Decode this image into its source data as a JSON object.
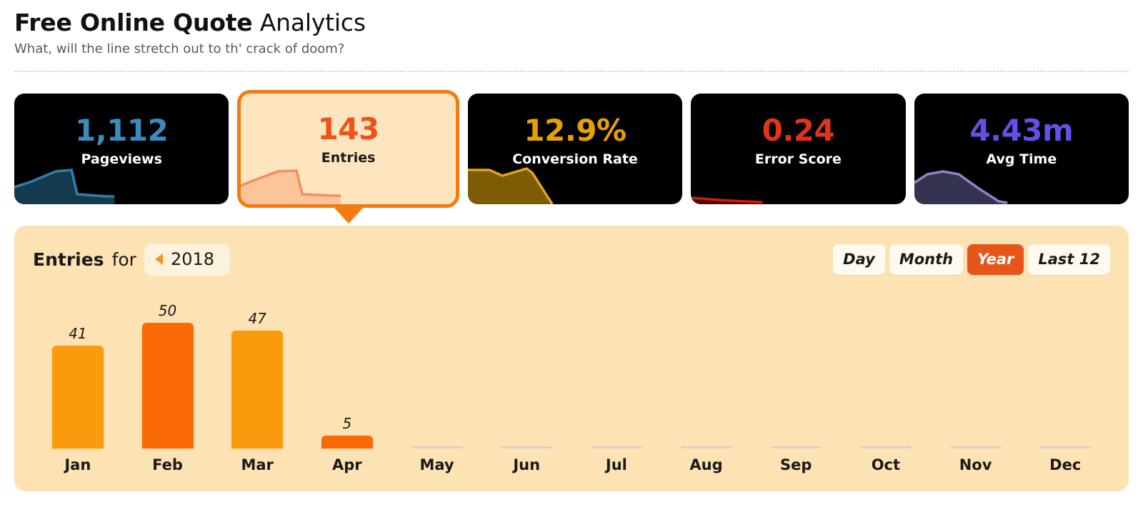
{
  "header": {
    "title_strong": "Free Online Quote",
    "title_rest": "Analytics",
    "subtitle": "What, will the line stretch out to th' crack of doom?"
  },
  "cards": [
    {
      "value": "1,112",
      "label": "Pageviews",
      "value_color": "#3a8cbe",
      "spark_line": "#2f7fae",
      "spark_fill": "#143a4e",
      "active": false
    },
    {
      "value": "143",
      "label": "Entries",
      "value_color": "#f0521a",
      "spark_line": "#f0915c",
      "spark_fill": "#fbc49a",
      "active": true
    },
    {
      "value": "12.9%",
      "label": "Conversion Rate",
      "value_color": "#e8a200",
      "spark_line": "#e0a51a",
      "spark_fill": "#7d5c06",
      "active": false
    },
    {
      "value": "0.24",
      "label": "Error Score",
      "value_color": "#e0341a",
      "spark_line": "#d41a0c",
      "spark_fill": "#4a0a04",
      "active": false
    },
    {
      "value": "4.43m",
      "label": "Avg Time",
      "value_color": "#6350e8",
      "spark_line": "#8d85c9",
      "spark_fill": "#343350",
      "active": false
    }
  ],
  "panel": {
    "title_strong": "Entries",
    "title_rest": "for",
    "year": "2018",
    "prev_year_arrow": "triangle-left-icon",
    "range_tabs": [
      {
        "label": "Day",
        "active": false
      },
      {
        "label": "Month",
        "active": false
      },
      {
        "label": "Year",
        "active": true
      },
      {
        "label": "Last 12",
        "active": false
      }
    ]
  },
  "chart_data": {
    "type": "bar",
    "title": "Entries for 2018",
    "xlabel": "",
    "ylabel": "Entries",
    "ylim": [
      0,
      50
    ],
    "grid": false,
    "legend": null,
    "categories": [
      "Jan",
      "Feb",
      "Mar",
      "Apr",
      "May",
      "Jun",
      "Jul",
      "Aug",
      "Sep",
      "Oct",
      "Nov",
      "Dec"
    ],
    "values": [
      41,
      50,
      47,
      5,
      0,
      0,
      0,
      0,
      0,
      0,
      0,
      0
    ],
    "value_labels": [
      "41",
      "50",
      "47",
      "5",
      "",
      "",
      "",
      "",
      "",
      "",
      "",
      ""
    ],
    "bar_colors": [
      "#f99b0c",
      "#f96a07",
      "#f99b0c",
      "#f96a07",
      "#d8d2c6",
      "#d8d2c6",
      "#d8d2c6",
      "#d8d2c6",
      "#d8d2c6",
      "#d8d2c6",
      "#d8d2c6",
      "#d8d2c6"
    ],
    "highlight_color": "#f96a07",
    "base_color": "#f99b0c",
    "zero_color": "#d8d2c6",
    "total": 143
  }
}
